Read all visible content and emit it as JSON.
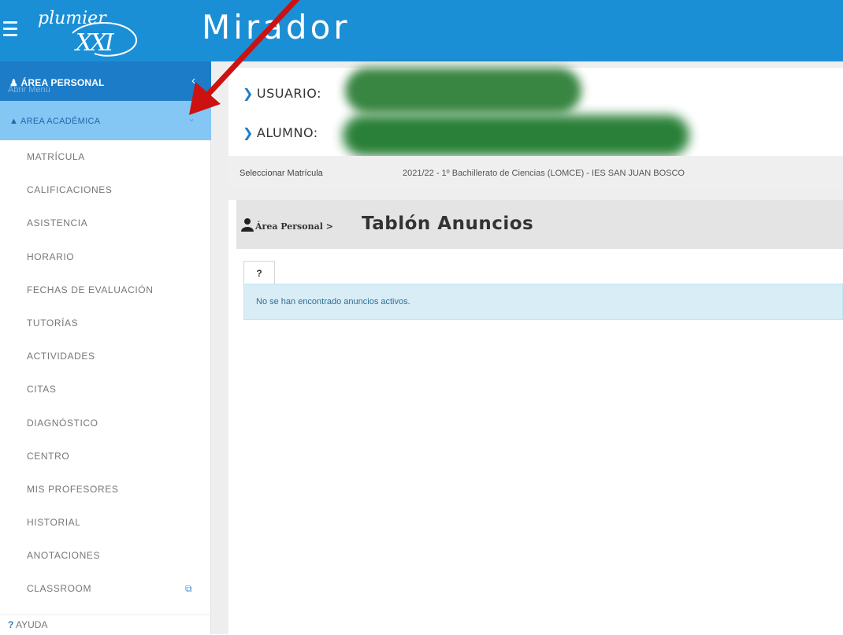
{
  "header": {
    "logo_text": "plumier XXI",
    "app_title": "Mirador"
  },
  "sidebar": {
    "personal_label": "ÁREA PERSONAL",
    "personal_ghost": "Abrir Menú",
    "academica_label": "AREA ACADÉMICA",
    "items": [
      {
        "label": "MATRÍCULA"
      },
      {
        "label": "CALIFICACIONES"
      },
      {
        "label": "ASISTENCIA"
      },
      {
        "label": "HORARIO"
      },
      {
        "label": "FECHAS DE EVALUACIÓN"
      },
      {
        "label": "TUTORÍAS"
      },
      {
        "label": "ACTIVIDADES"
      },
      {
        "label": "CITAS"
      },
      {
        "label": "DIAGNÓSTICO"
      },
      {
        "label": "CENTRO"
      },
      {
        "label": "MIS PROFESORES"
      },
      {
        "label": "HISTORIAL"
      },
      {
        "label": "ANOTACIONES"
      },
      {
        "label": "CLASSROOM"
      }
    ],
    "help_label": "AYUDA"
  },
  "info": {
    "usuario_label": "USUARIO:",
    "alumno_label": "ALUMNO:",
    "matricula_label": "Seleccionar Matrícula",
    "matricula_value": "2021/22 - 1º Bachillerato de Ciencias (LOMCE) - IES SAN JUAN BOSCO"
  },
  "page": {
    "breadcrumb": "Área Personal >",
    "title": "Tablón Anuncios",
    "help_tab": "?",
    "notice": "No se han encontrado anuncios activos."
  },
  "colors": {
    "header_blue": "#1b8fd6",
    "sidebar_active": "#1c7cc7",
    "sidebar_selected": "#84c6f4",
    "notice_bg": "#d9edf7",
    "annotation_red": "#cc1111"
  },
  "icons": {
    "menu": "hamburger-icon",
    "user": "user-icon",
    "graduation": "graduation-cap-icon",
    "external": "external-link-icon",
    "chevron": "chevron-right-icon"
  }
}
